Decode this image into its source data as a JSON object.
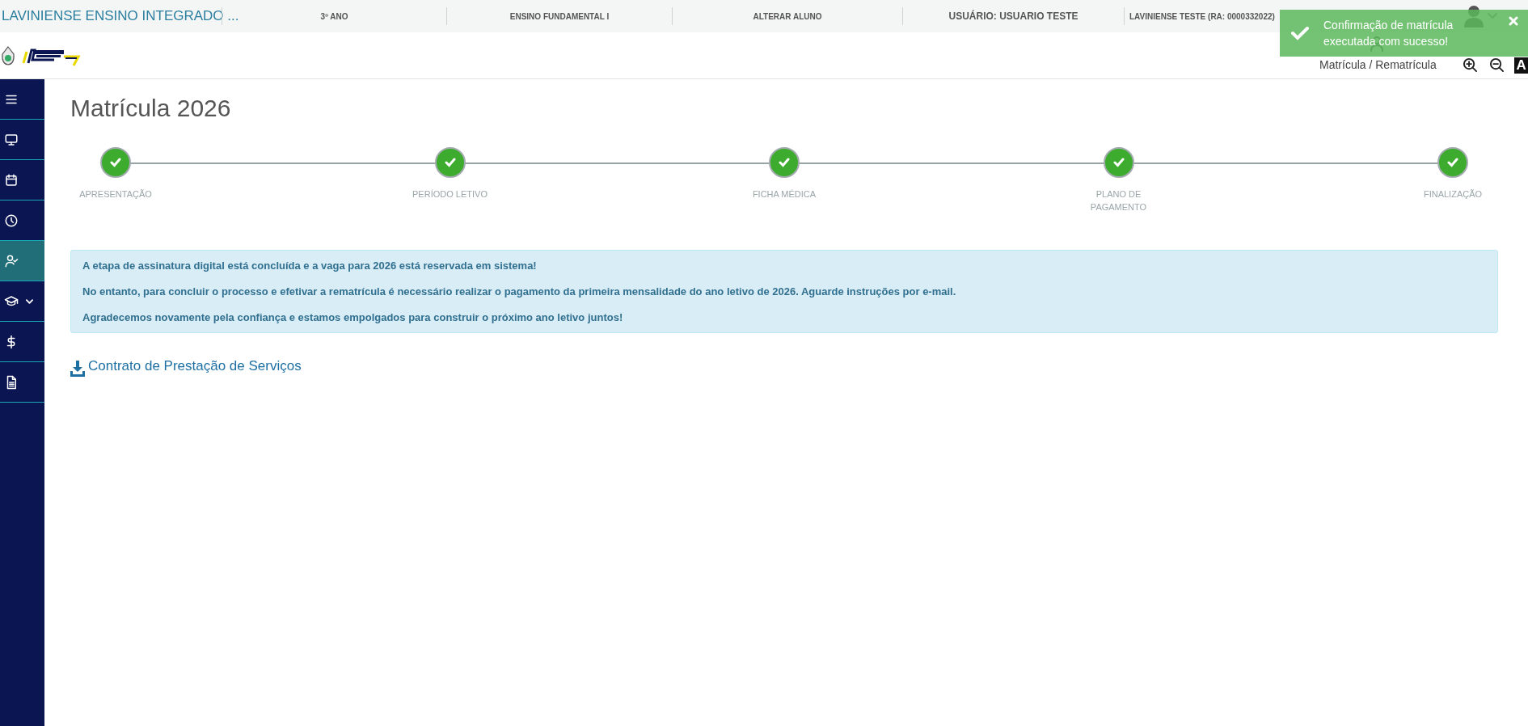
{
  "top_bar": {
    "school": "LAVINIENSE ENSINO INTEGRADO ...",
    "items": [
      "3º ANO",
      "ENSINO FUNDAMENTAL I",
      "ALTERAR ALUNO",
      "USUÁRIO: USUARIO TESTE",
      "LAVINIENSE TESTE (RA: 0000332022)"
    ]
  },
  "header": {
    "breadcrumb": "Matrícula / Rematrícula",
    "contrast_label": "A"
  },
  "sidebar": {
    "items": [
      {
        "kind": "menu",
        "selected": false,
        "submenu": false
      },
      {
        "kind": "monitor",
        "selected": false,
        "submenu": false
      },
      {
        "kind": "calendar",
        "selected": false,
        "submenu": false
      },
      {
        "kind": "clock",
        "selected": false,
        "submenu": false
      },
      {
        "kind": "user-check",
        "selected": true,
        "submenu": false
      },
      {
        "kind": "graduation",
        "selected": false,
        "submenu": true
      },
      {
        "kind": "dollar",
        "selected": false,
        "submenu": false
      },
      {
        "kind": "document",
        "selected": false,
        "submenu": false
      }
    ]
  },
  "page_title": "Matrícula 2026",
  "steps": [
    {
      "label": "APRESENTAÇÃO",
      "done": true
    },
    {
      "label": "PERÍODO LETIVO",
      "done": true
    },
    {
      "label": "FICHA MÉDICA",
      "done": true
    },
    {
      "label": "PLANO DE PAGAMENTO",
      "done": true
    },
    {
      "label": "FINALIZAÇÃO",
      "done": true
    }
  ],
  "alert": {
    "lines": [
      "A etapa de assinatura digital está concluída e a vaga para 2026 está reservada em sistema!",
      "No entanto, para concluir o processo e efetivar a rematrícula é necessário realizar o pagamento da primeira mensalidade do ano letivo de 2026. Aguarde instruções por e-mail.",
      "Agradecemos novamente pela confiança e estamos empolgados para construir o próximo ano letivo juntos!"
    ]
  },
  "download_link": "Contrato de Prestação de Serviços",
  "toast": {
    "message": "Confirmação de matrícula executada com sucesso!"
  }
}
